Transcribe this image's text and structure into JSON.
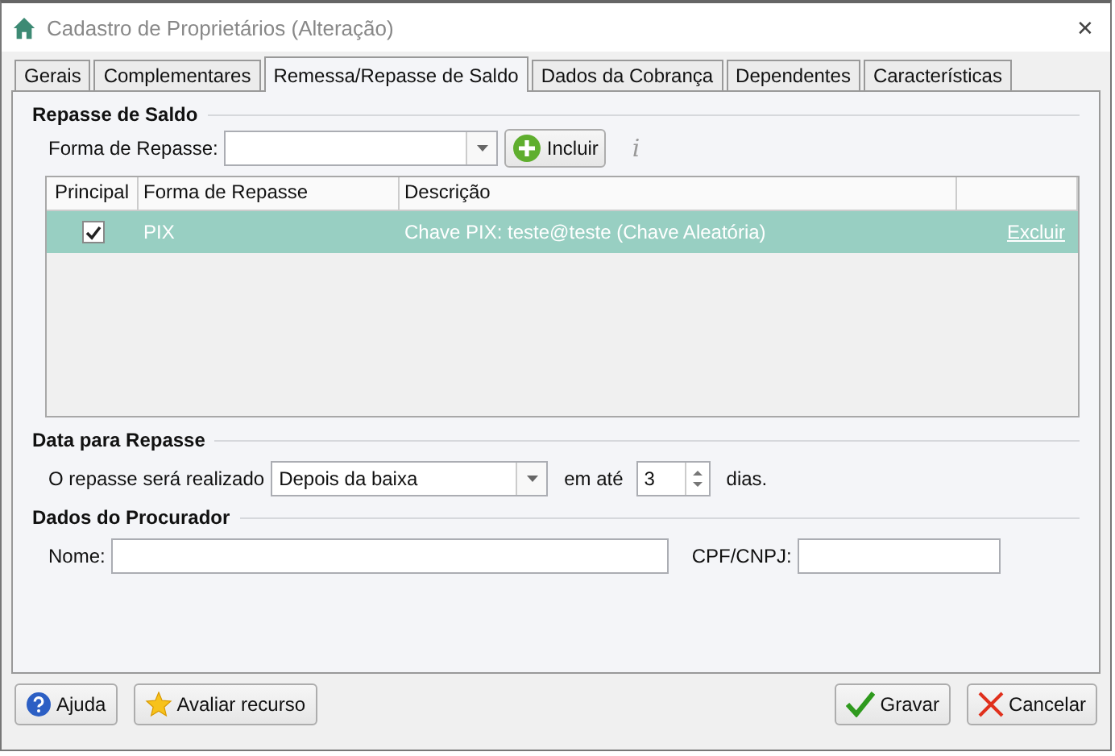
{
  "window": {
    "title": "Cadastro de Proprietários (Alteração)",
    "close": "✕"
  },
  "tabs": [
    {
      "label": "Gerais",
      "selected": false
    },
    {
      "label": "Complementares",
      "selected": false
    },
    {
      "label": "Remessa/Repasse de Saldo",
      "selected": true
    },
    {
      "label": "Dados da Cobrança",
      "selected": false
    },
    {
      "label": "Dependentes",
      "selected": false
    },
    {
      "label": "Características",
      "selected": false
    }
  ],
  "repasse": {
    "heading": "Repasse de Saldo",
    "forma_label": "Forma de Repasse:",
    "add_button": "Incluir",
    "info": "i",
    "table": {
      "columns": [
        "Principal",
        "Forma de Repasse",
        "Descrição"
      ],
      "rows": [
        {
          "principal": true,
          "forma": "PIX",
          "descricao": "Chave PIX: teste@teste (Chave Aleatória)",
          "action": "Excluir",
          "selected": true
        }
      ]
    }
  },
  "data": {
    "heading": "Data para Repasse",
    "label": "O repasse será realizado",
    "option": "Depois da baixa",
    "em_ate": "em até",
    "days": "3",
    "unit": "dias."
  },
  "procurador": {
    "heading": "Dados do Procurador",
    "nome_label": "Nome:",
    "cpf_label": "CPF/CNPJ:"
  },
  "buttons": [
    {
      "kind": "help",
      "label": "Ajuda"
    },
    {
      "kind": "rate",
      "label": "Avaliar recurso"
    },
    {
      "kind": "save",
      "label": "Gravar"
    },
    {
      "kind": "cancel",
      "label": "Cancelar"
    }
  ]
}
